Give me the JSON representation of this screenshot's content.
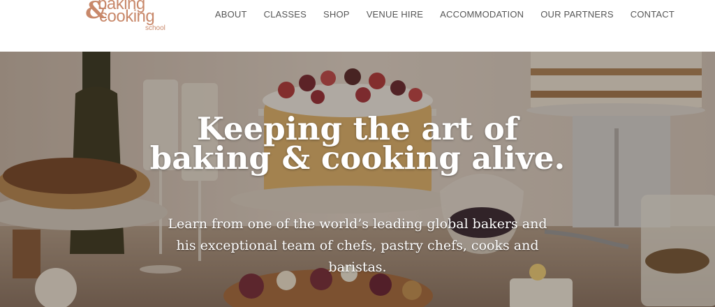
{
  "brand": {
    "line1": "baking",
    "ampersand": "&",
    "line2": "cooking",
    "line3": "school",
    "color": "#c8886a"
  },
  "nav": {
    "items": [
      {
        "label": "ABOUT"
      },
      {
        "label": "CLASSES"
      },
      {
        "label": "SHOP"
      },
      {
        "label": "VENUE HIRE"
      },
      {
        "label": "ACCOMMODATION"
      },
      {
        "label": "OUR PARTNERS"
      },
      {
        "label": "CONTACT"
      }
    ]
  },
  "hero": {
    "headline": "Keeping the art of baking & cooking alive.",
    "subline": "Learn from one of the world’s leading global bakers and his exceptional team of chefs, pastry chefs, cooks and baristas.",
    "image": "food-spread-photo"
  }
}
